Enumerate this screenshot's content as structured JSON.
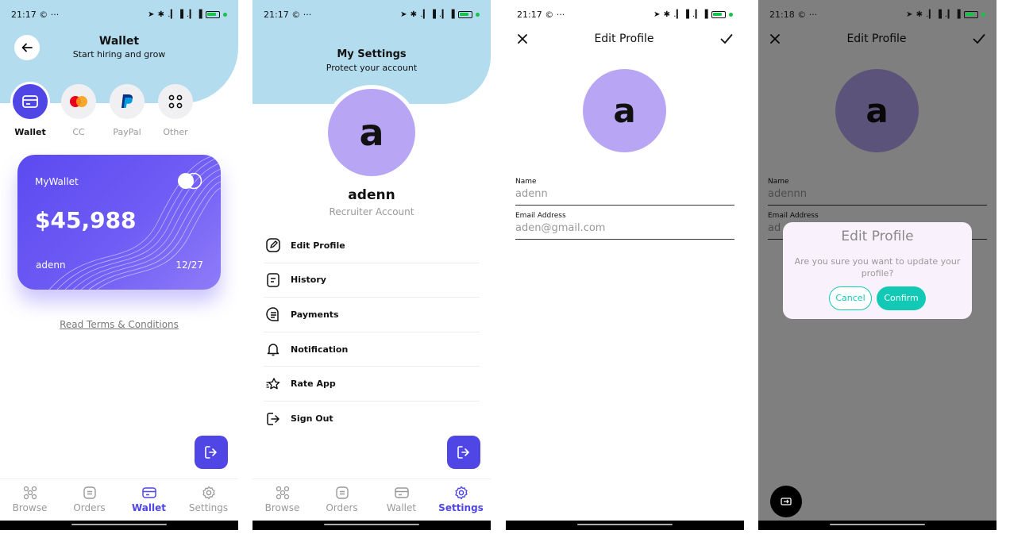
{
  "status": {
    "s1_time": "21:17",
    "s2_time": "21:17",
    "s3_time": "21:17",
    "s4_time": "21:18",
    "extra": "© ···",
    "signals": "➤ ✱ .▎▐ .▎▐",
    "battery": "80"
  },
  "wallet": {
    "title": "Wallet",
    "subtitle": "Start hiring and grow",
    "methods": [
      "Wallet",
      "CC",
      "PayPal",
      "Other"
    ],
    "card": {
      "name": "MyWallet",
      "amount": "$45,988",
      "owner": "adenn",
      "expiry": "12/27"
    },
    "terms_link": "Read Terms & Conditions"
  },
  "tabs": [
    "Browse",
    "Orders",
    "Wallet",
    "Settings"
  ],
  "settings": {
    "title": "My Settings",
    "subtitle": "Protect your account",
    "avatar_letter": "a",
    "username": "adenn",
    "role": "Recruiter Account",
    "menu": [
      "Edit Profile",
      "History",
      "Payments",
      "Notification",
      "Rate App",
      "Sign Out"
    ]
  },
  "edit_profile": {
    "title": "Edit Profile",
    "avatar_letter": "a",
    "name_label": "Name",
    "name_value": "adenn",
    "email_label": "Email Address",
    "email_value": "aden@gmail.com"
  },
  "confirm_screen": {
    "title": "Edit Profile",
    "avatar_letter": "a",
    "name_label": "Name",
    "name_value": "adennn",
    "email_label": "Email Address",
    "email_value": "ad",
    "dialog": {
      "title": "Edit Profile",
      "message": "Are you sure you want to update your profile?",
      "cancel": "Cancel",
      "confirm": "Confirm"
    }
  },
  "colors": {
    "accent": "#4f46e5",
    "header_bg": "#b4dcef",
    "avatar": "#b8a6f5",
    "teal": "#11c9b4"
  }
}
